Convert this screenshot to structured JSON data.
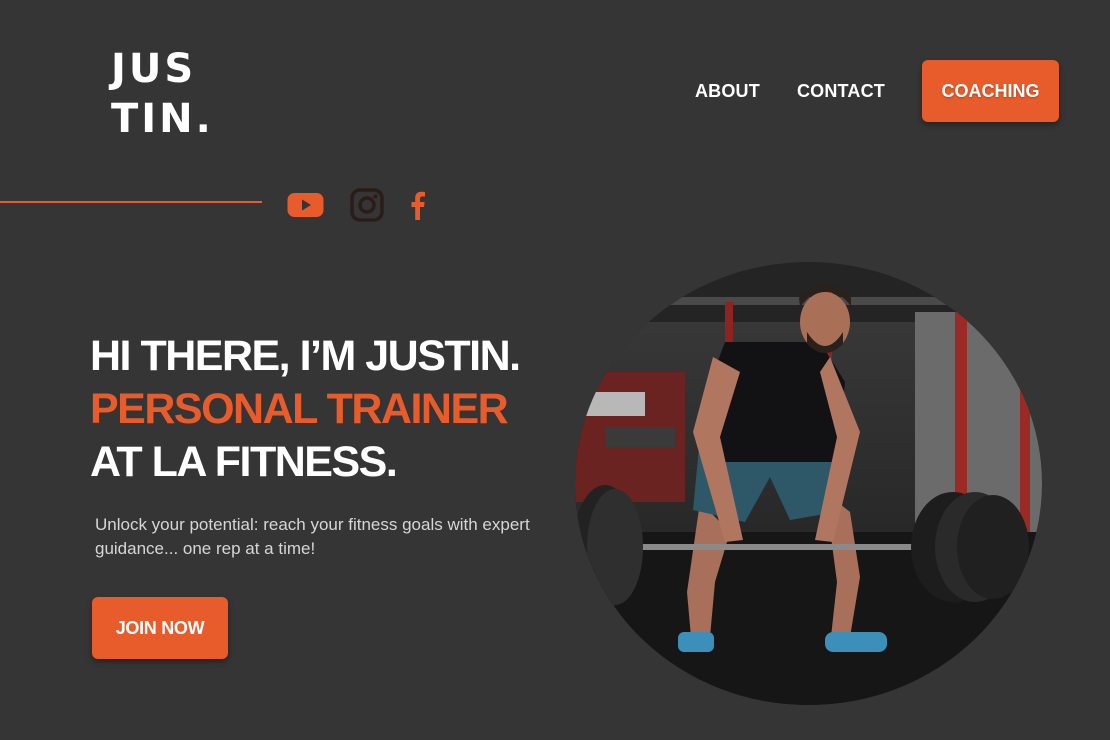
{
  "brand": {
    "logo_line1": "JUS",
    "logo_line2": "TIN."
  },
  "nav": {
    "about": "ABOUT",
    "contact": "CONTACT",
    "coaching": "COACHING"
  },
  "social": {
    "icons": [
      "youtube-icon",
      "instagram-icon",
      "facebook-icon"
    ]
  },
  "hero": {
    "line1": "HI THERE, I’M JUSTIN.",
    "line2": "PERSONAL TRAINER",
    "line3": "AT LA FITNESS.",
    "subtitle": "Unlock your potential: reach your fitness goals with expert guidance... one rep at a time!",
    "cta": "JOIN NOW"
  },
  "colors": {
    "accent": "#e85c2c",
    "background": "#353535",
    "text": "#ffffff",
    "muted": "#d6d6d6"
  }
}
